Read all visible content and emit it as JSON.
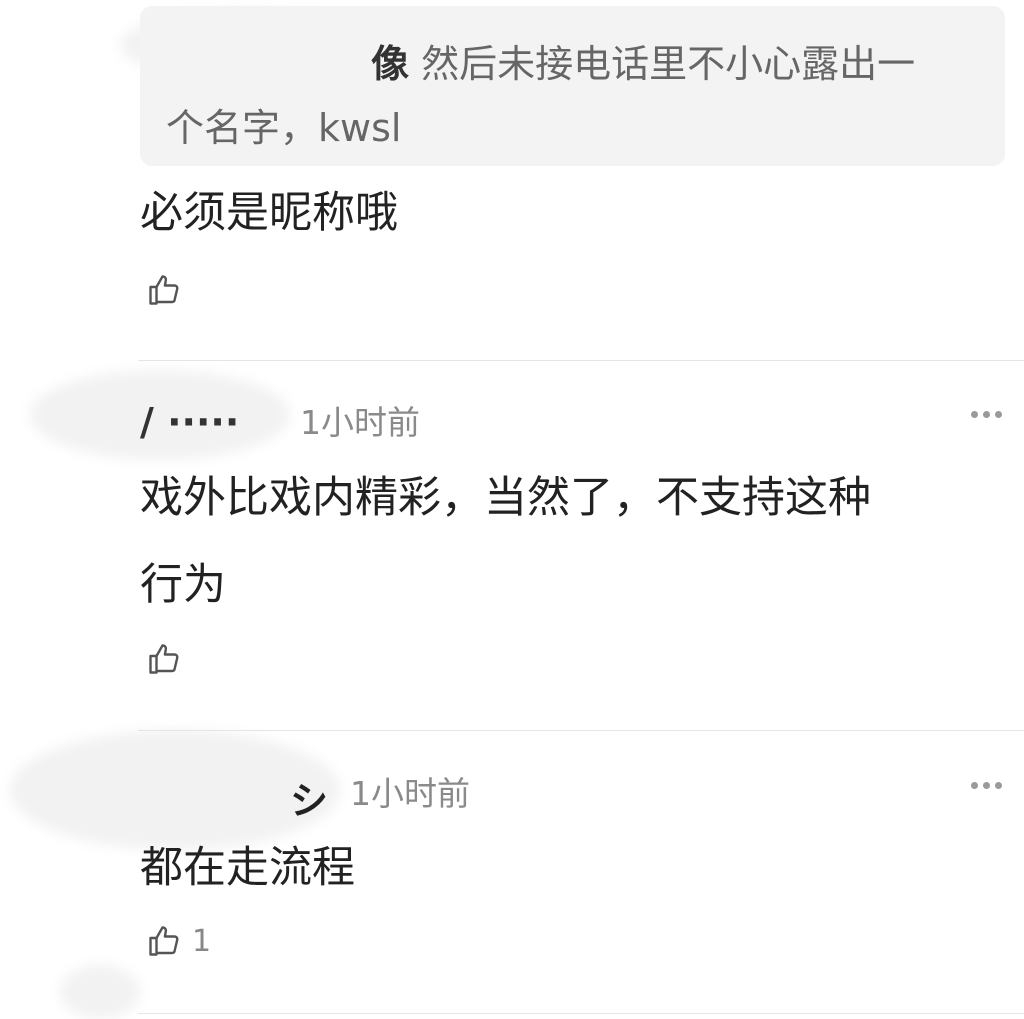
{
  "quote": {
    "author": "像",
    "text_line1": "然后未接电话里不小心露出一",
    "text_line2": "个名字，kwsl"
  },
  "comments": [
    {
      "text": "必须是昵称哦",
      "likes": ""
    },
    {
      "time": "1小时前",
      "text_line1": "戏外比戏内精彩，当然了，不支持这种",
      "text_line2": "行为",
      "likes": ""
    },
    {
      "time": "1小时前",
      "text": "都在走流程",
      "likes": "1"
    }
  ],
  "icons": {
    "like": "thumbs-up-icon",
    "more": "more-options-icon"
  },
  "colors": {
    "quote_bg": "#f3f3f3",
    "meta_text": "#8a8a8a",
    "divider": "#e5e5e5"
  }
}
